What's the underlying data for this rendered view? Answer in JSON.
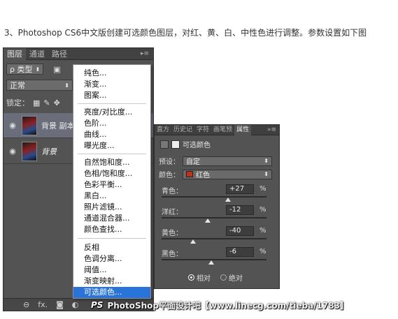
{
  "caption": "3、Photoshop CS6中文版创建可选颜色图层，对红、黄、白、中性色进行调整。参数设置如下图",
  "layers_panel": {
    "tabs": [
      "图层",
      "通道",
      "路径"
    ],
    "filter_label": "ρ 类型",
    "blend_mode": "正常",
    "lock_label": "锁定：",
    "layers": [
      {
        "name": "背景 副本"
      },
      {
        "name": "背景"
      }
    ],
    "bottom_icons": [
      "link-icon",
      "fx-icon",
      "mask-icon",
      "adjustment-icon"
    ],
    "fx_label": "fx."
  },
  "adjust_menu": {
    "group1": [
      "纯色...",
      "渐变...",
      "图案..."
    ],
    "group2": [
      "亮度/对比度...",
      "色阶...",
      "曲线...",
      "曝光度..."
    ],
    "group3": [
      "自然饱和度...",
      "色相/饱和度...",
      "色彩平衡...",
      "黑白...",
      "照片滤镜...",
      "通道混合器...",
      "颜色查找..."
    ],
    "group4": [
      "反相",
      "色调分离...",
      "阈值...",
      "渐变映射...",
      "可选颜色..."
    ],
    "highlighted": "可选颜色..."
  },
  "properties": {
    "tabs": [
      "直方",
      "历史记",
      "字符",
      "画笔预",
      "属性"
    ],
    "title": "可选颜色",
    "preset_label": "预设：",
    "preset_value": "自定",
    "color_label": "颜色：",
    "color_value": "红色",
    "color_swatch": "#c0301a",
    "sliders": [
      {
        "label": "青色：",
        "value": "+27",
        "unit": "%",
        "fraction": 0.635
      },
      {
        "label": "洋红：",
        "value": "-12",
        "unit": "%",
        "fraction": 0.44
      },
      {
        "label": "黄色：",
        "value": "-40",
        "unit": "%",
        "fraction": 0.3
      },
      {
        "label": "黑色：",
        "value": "-6",
        "unit": "%",
        "fraction": 0.47
      }
    ],
    "method_relative": "相对",
    "method_absolute": "绝对"
  },
  "watermark": {
    "logo": "PS",
    "text": "PhotoShop平面设计吧【www.linecg.com/tieba/1783】"
  }
}
